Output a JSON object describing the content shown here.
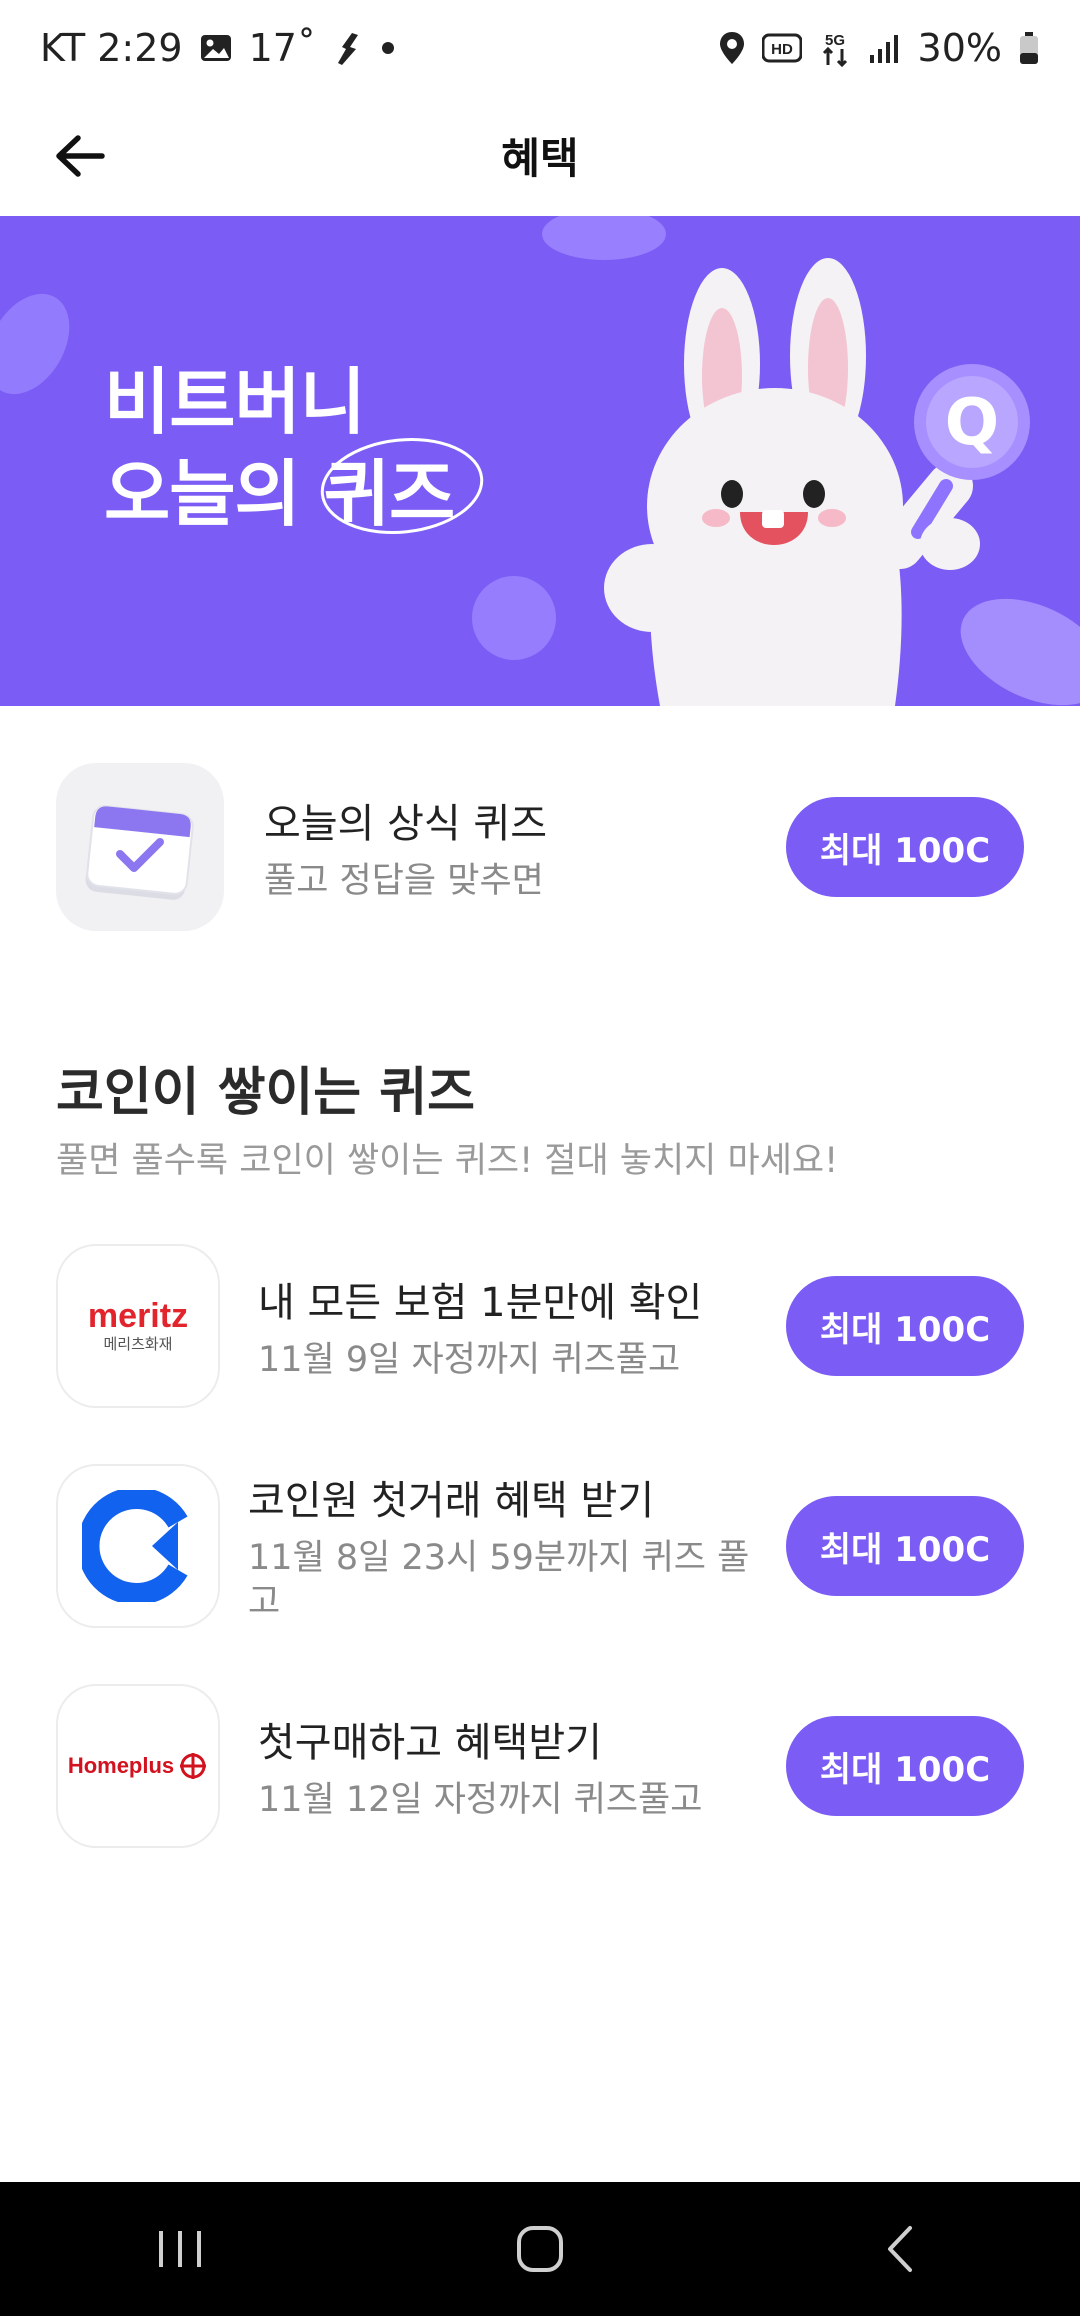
{
  "status_bar": {
    "carrier_time": "KT 2:29",
    "temperature": "17˚",
    "battery": "30%",
    "icons": [
      "image-icon",
      "weather-icon",
      "dot-icon",
      "location-icon",
      "hd-icon",
      "5g-icon",
      "signal-icon",
      "battery-icon"
    ]
  },
  "header": {
    "title": "혜택",
    "back_icon": "arrow-left-icon"
  },
  "banner": {
    "line1": "비트버니",
    "line2_prefix": "오늘의 ",
    "line2_circled": "퀴즈",
    "bg_color": "#7b5cf5"
  },
  "daily_quiz": {
    "title": "오늘의 상식 퀴즈",
    "subtitle": "풀고 정답을 맞추면",
    "button": "최대 100C",
    "icon": "calendar-check-icon"
  },
  "section": {
    "title": "코인이 쌓이는 퀴즈",
    "subtitle": "풀면 풀수록 코인이 쌓이는 퀴즈! 절대 놓치지 마세요!"
  },
  "quizzes": [
    {
      "logo": "meritz-logo",
      "logo_text": "meritz",
      "logo_sub": "메리츠화재",
      "title": "내 모든 보험 1분만에 확인",
      "subtitle": "11월 9일 자정까지 퀴즈풀고",
      "button": "최대 100C"
    },
    {
      "logo": "coinone-logo",
      "title": "코인원 첫거래 혜택 받기",
      "subtitle": "11월 8일 23시 59분까지 퀴즈 풀고",
      "button": "최대 100C"
    },
    {
      "logo": "homeplus-logo",
      "logo_text": "Homeplus",
      "title": "첫구매하고 혜택받기",
      "subtitle": "11월 12일 자정까지 퀴즈풀고",
      "button": "최대 100C"
    }
  ],
  "accent_color": "#7b5cf5",
  "nav_icons": [
    "recent-apps-icon",
    "home-icon",
    "back-icon"
  ]
}
